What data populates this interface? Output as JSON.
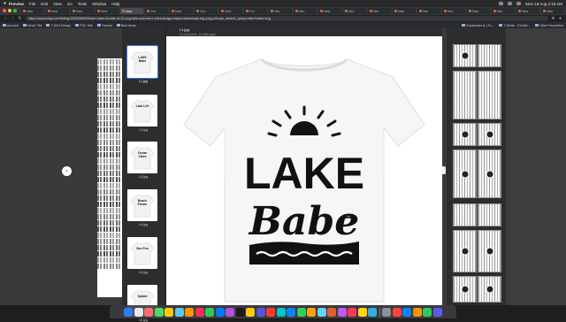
{
  "menubar": {
    "app_name": "Preview",
    "menu_items": [
      "File",
      "Edit",
      "View",
      "Go",
      "Tools",
      "Window",
      "Help"
    ],
    "clock": "Mon 18 Aug 2:16 AM"
  },
  "tabs": [
    {
      "label": "New",
      "active": false
    },
    {
      "label": "New",
      "active": false
    },
    {
      "label": "New",
      "active": false
    },
    {
      "label": "New",
      "active": false
    },
    {
      "label": "New",
      "active": true
    },
    {
      "label": "Ont",
      "active": false
    },
    {
      "label": "New",
      "active": false
    },
    {
      "label": "Oro",
      "active": false
    },
    {
      "label": "Wed",
      "active": false
    },
    {
      "label": "Fun",
      "active": false
    },
    {
      "label": "Nev",
      "active": false
    },
    {
      "label": "Nev",
      "active": false
    },
    {
      "label": "New",
      "active": false
    },
    {
      "label": "Nev",
      "active": false
    },
    {
      "label": "Nev",
      "active": false
    },
    {
      "label": "New",
      "active": false
    },
    {
      "label": "Nev",
      "active": false
    },
    {
      "label": "Nev",
      "active": false
    },
    {
      "label": "New",
      "active": false
    },
    {
      "label": "Nev",
      "active": false
    },
    {
      "label": "New",
      "active": false
    },
    {
      "label": "New",
      "active": false
    }
  ],
  "address": {
    "url": "https://www.etsy.com/listing/1505098463/lake-babe-bundle-of-10-svg-lake-summer-t-shirt-design-instant-download-svg-png-pdf-eps_search_query=lake+babe+svg"
  },
  "bookmarks": {
    "items": [
      "Account",
      "Never File",
      "T-Shirt Design",
      "PDC Site",
      "Tutorial",
      "Best Ideas"
    ],
    "right_items": [
      "Downloads le | To...",
      "T-Shirts - Gem&t...",
      "Other Favourites"
    ]
  },
  "viewer": {
    "file_name": "L1.jpg",
    "file_info": "11 documents, 10 total pages",
    "shirt_text_line1": "LAKE",
    "shirt_text_line2": "Babe"
  },
  "sidebar": {
    "thumbs": [
      {
        "label": "L1.jpg",
        "caption": "LAKE Babe",
        "selected": true
      },
      {
        "label": "L2.jpg",
        "caption": "Lake Life",
        "selected": false
      },
      {
        "label": "L3.jpg",
        "caption": "Ocean Vibes",
        "selected": false
      },
      {
        "label": "L4.jpg",
        "caption": "Beach Please",
        "selected": false
      },
      {
        "label": "L5.jpg",
        "caption": "Sun Fun",
        "selected": false
      },
      {
        "label": "L6.jpg",
        "caption": "Splash",
        "selected": false
      }
    ]
  },
  "colors": {
    "selection": "#3478f6",
    "ink": "#111111",
    "wood": "#ffffff"
  }
}
